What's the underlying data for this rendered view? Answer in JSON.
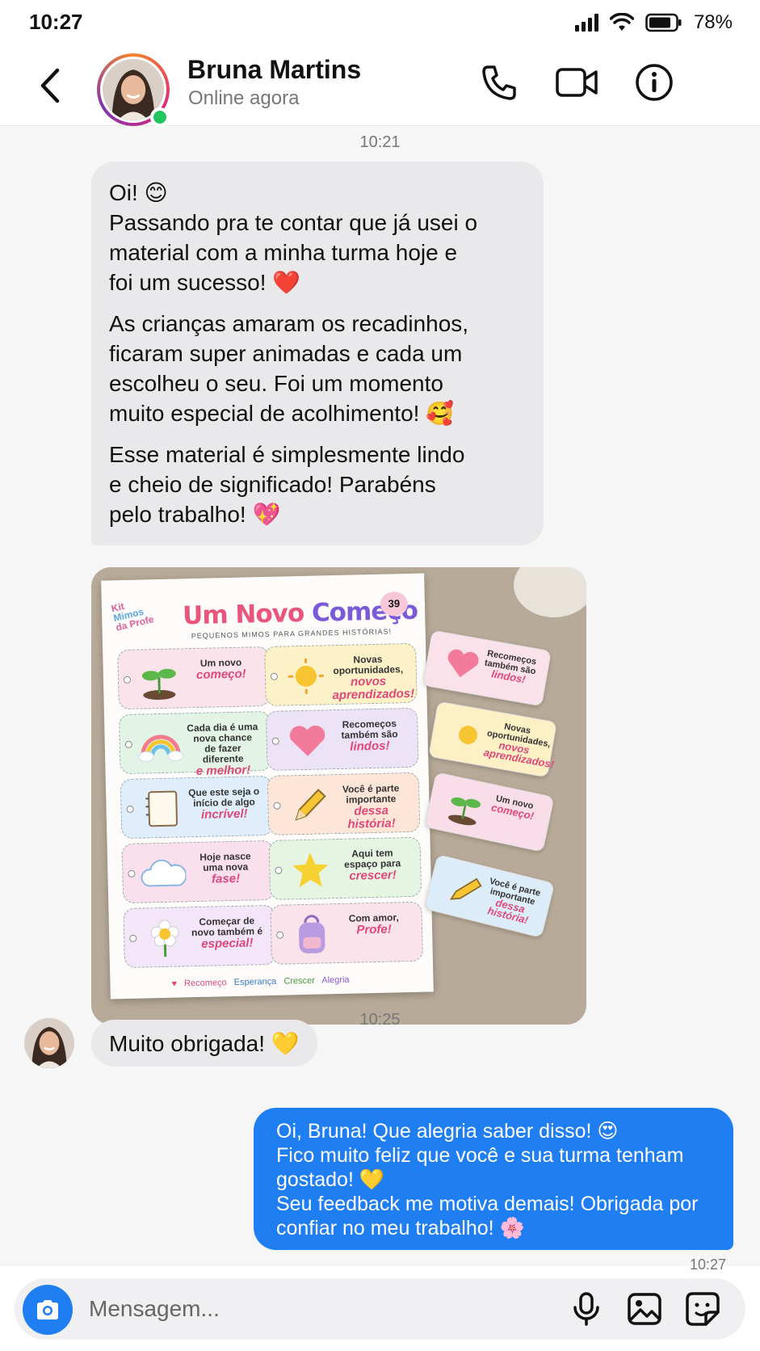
{
  "status_bar": {
    "time": "10:27",
    "battery": "78%"
  },
  "header": {
    "contact_name": "Bruna Martins",
    "contact_status": "Online agora"
  },
  "messages": {
    "time1": "10:21",
    "incoming_1_p1_line1": "Oi! 😊",
    "incoming_1_p1_line2": "Passando pra te contar que já usei o",
    "incoming_1_p1_line3": "material com a minha turma hoje e",
    "incoming_1_p1_line4": "foi um sucesso! ❤️",
    "incoming_1_p2_line1": "As crianças amaram os recadinhos,",
    "incoming_1_p2_line2": "ficaram super animadas e cada um",
    "incoming_1_p2_line3": "escolheu o seu. Foi um momento",
    "incoming_1_p2_line4": "muito especial de acolhimento! 🥰",
    "incoming_1_p3_line1": "Esse material é simplesmente lindo",
    "incoming_1_p3_line2": "e cheio de significado! Parabéns",
    "incoming_1_p3_line3": "pelo trabalho! 💖",
    "incoming_2": "Muito obrigada! 💛",
    "time2": "10:25",
    "outgoing_line1": "Oi, Bruna! Que alegria saber disso! 😍",
    "outgoing_line2": "Fico muito feliz que você e sua turma tenham",
    "outgoing_line3": "gostado! 💛",
    "outgoing_line4": "Seu feedback me motiva demais! Obrigada por",
    "outgoing_line5": "confiar no meu trabalho! 🌸",
    "time3": "10:27"
  },
  "photo": {
    "kit_logo_1": "Kit",
    "kit_logo_2": "Mimos",
    "kit_logo_3": "da Profe",
    "title_a": "Um Novo ",
    "title_b": "Começo",
    "subtitle": "PEQUENOS MIMOS PARA GRANDES HISTÓRIAS!",
    "badge": "39",
    "cards": [
      {
        "text": "Um novo",
        "accent": "começo!"
      },
      {
        "text": "Novas oportunidades,",
        "accent": "novos aprendizados!"
      },
      {
        "text": "Cada dia é uma nova chance de fazer diferente",
        "accent": "e melhor!"
      },
      {
        "text": "Recomeços também são",
        "accent": "lindos!"
      },
      {
        "text": "Que este seja o início de algo",
        "accent": "incrível!"
      },
      {
        "text": "Você é parte importante",
        "accent": "dessa história!"
      },
      {
        "text": "Hoje nasce uma nova",
        "accent": "fase!"
      },
      {
        "text": "Aqui tem espaço para",
        "accent": "crescer!"
      },
      {
        "text": "Começar de novo também é",
        "accent": "especial!"
      },
      {
        "text": "Com amor,",
        "accent": "Profe!"
      }
    ],
    "footer": [
      "Recomeço",
      "Esperança",
      "Crescer",
      "Alegria"
    ],
    "tags": [
      {
        "text": "Recomeços também são",
        "accent": "lindos!"
      },
      {
        "text": "Novas oportunidades,",
        "accent": "novos aprendizados!"
      },
      {
        "text": "Um novo",
        "accent": "começo!"
      },
      {
        "text": "Você é parte importante",
        "accent": "dessa história!"
      }
    ]
  },
  "input": {
    "placeholder": "Mensagem..."
  },
  "colors": {
    "accent": "#1f7ef2",
    "incoming_bubble": "#e9e9eb",
    "online": "#22c55e"
  }
}
